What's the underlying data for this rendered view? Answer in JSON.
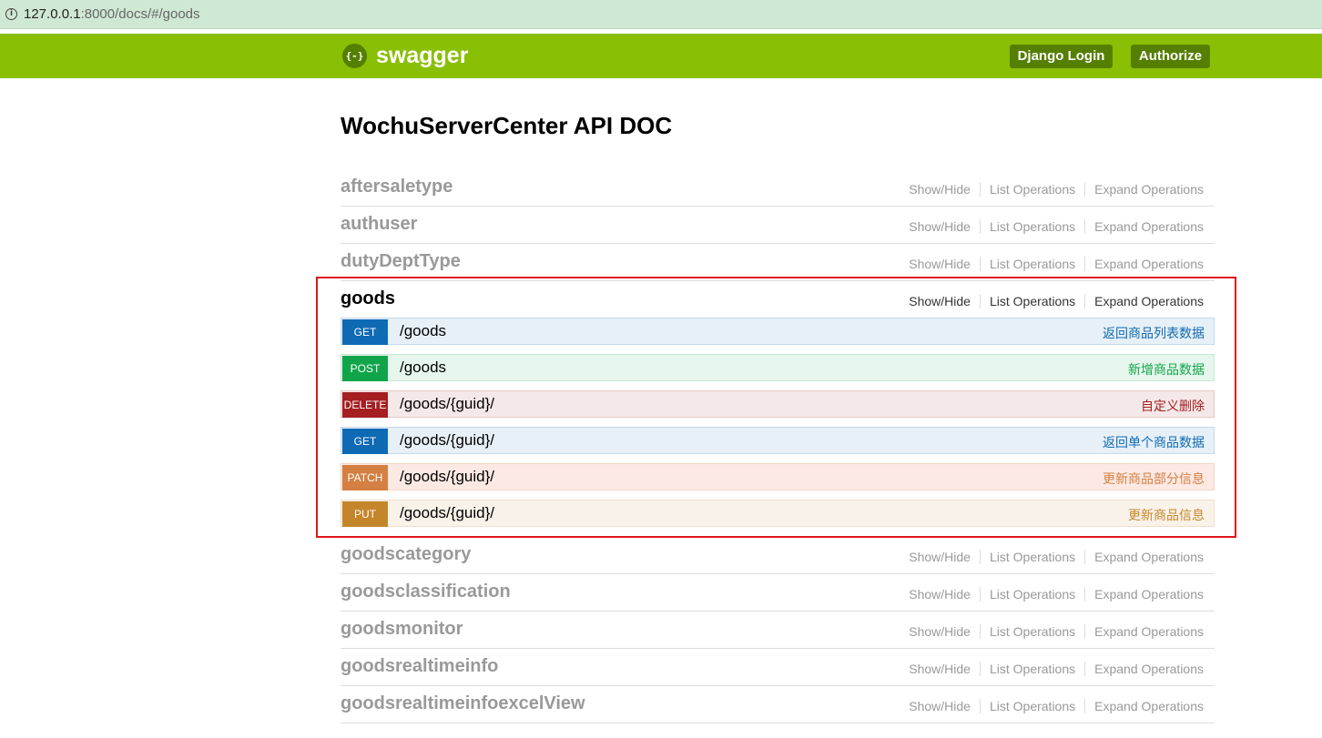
{
  "browser": {
    "url_host": "127.0.0.1",
    "url_rest": ":8000/docs/#/goods"
  },
  "header": {
    "logo_icon": "{-}",
    "logo_text": "swagger",
    "login_label": "Django Login",
    "authorize_label": "Authorize"
  },
  "page_title": "WochuServerCenter API DOC",
  "ops_labels": {
    "show_hide": "Show/Hide",
    "list": "List Operations",
    "expand": "Expand Operations"
  },
  "resources_top": [
    {
      "name": "aftersaletype"
    },
    {
      "name": "authuser"
    },
    {
      "name": "dutyDeptType"
    }
  ],
  "active_resource": {
    "name": "goods",
    "endpoints": [
      {
        "method": "GET",
        "path": "/goods",
        "desc": "返回商品列表数据",
        "style": "get"
      },
      {
        "method": "POST",
        "path": "/goods",
        "desc": "新增商品数据",
        "style": "post"
      },
      {
        "method": "DELETE",
        "path": "/goods/{guid}/",
        "desc": "自定义删除",
        "style": "delete"
      },
      {
        "method": "GET",
        "path": "/goods/{guid}/",
        "desc": "返回单个商品数据",
        "style": "get"
      },
      {
        "method": "PATCH",
        "path": "/goods/{guid}/",
        "desc": "更新商品部分信息",
        "style": "patch"
      },
      {
        "method": "PUT",
        "path": "/goods/{guid}/",
        "desc": "更新商品信息",
        "style": "put"
      }
    ]
  },
  "resources_bottom": [
    {
      "name": "goodscategory"
    },
    {
      "name": "goodsclassification"
    },
    {
      "name": "goodsmonitor"
    },
    {
      "name": "goodsrealtimeinfo"
    },
    {
      "name": "goodsrealtimeinfoexcelView"
    }
  ],
  "colors": {
    "header_green": "#89bf04",
    "button_dark_green": "#547f00",
    "highlight_red": "#e0151b",
    "get": "#0f6ab4",
    "post": "#10a54a",
    "delete": "#a41e22",
    "patch": "#d38042",
    "put": "#c5862b"
  }
}
